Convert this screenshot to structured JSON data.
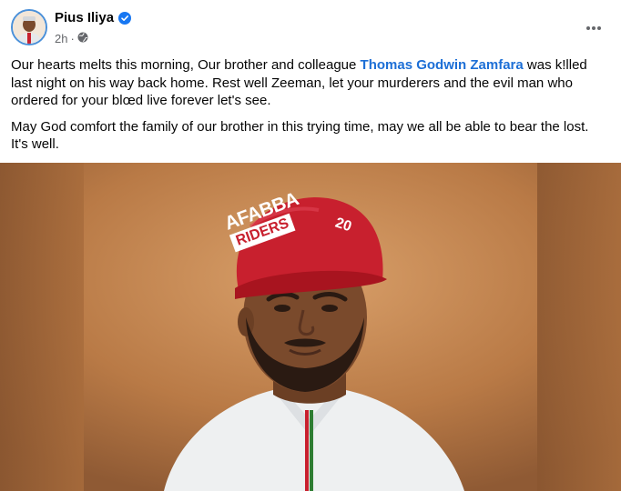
{
  "post": {
    "author": {
      "name": "Pius Iliya",
      "verified": true,
      "time": "2h",
      "dot": "·",
      "audience_icon": "globe-icon",
      "avatar_icon": "profile-photo"
    },
    "more_icon": "more-horizontal-icon",
    "text": {
      "p1_before": "Our hearts melts this morning, Our brother and colleague ",
      "mention": "Thomas Godwin Zamfara",
      "p1_after": " was k!lled last night on his way back home. Rest well Zeeman, let your murderers and the evil man who ordered for your blœd live forever let's see.",
      "p2": "May God comfort the family of our brother in this trying time, may we all be able to bear the lost. It's well."
    },
    "photo": {
      "cap_text_line1": "AFABBA",
      "cap_text_line2": "RIDERS",
      "cap_side_text": "20",
      "colors": {
        "backdrop": "#c4874f",
        "cap": "#c8202e",
        "outfit": "#eef0f1",
        "accent": "#1d6fd6"
      }
    }
  }
}
